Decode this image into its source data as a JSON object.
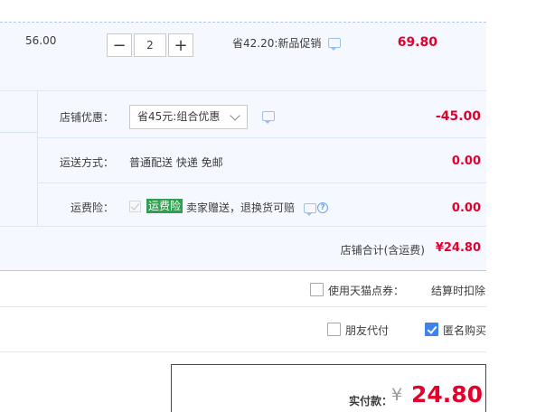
{
  "item": {
    "unit_price": "56.00",
    "minus_label": "−",
    "quantity": "2",
    "plus_label": "+",
    "promo_text": "省42.20:新品促销",
    "total": "69.80"
  },
  "shop": {
    "discount_label": "店铺优惠：",
    "discount_select": "省45元:组合优惠",
    "discount_value": "-45.00",
    "shipping_label": "运送方式：",
    "shipping_text": "普通配送 快递 免邮",
    "shipping_value": "0.00",
    "insurance_label": "运费险：",
    "insurance_tag": "运费险",
    "insurance_text": "卖家赠送，退换货可赔",
    "insurance_value": "0.00",
    "help_glyph": "?",
    "subtotal_label": "店铺合计(含运费)",
    "subtotal_value": "¥24.80"
  },
  "options": {
    "tmall_points_label": "使用天猫点券：",
    "tmall_points_note": "结算时扣除",
    "friend_pay_label": "朋友代付",
    "anonymous_label": "匿名购买"
  },
  "payment": {
    "label": "实付款：",
    "currency": "¥",
    "amount": "24.80"
  },
  "colors": {
    "accent_red": "#e4002b",
    "row_bg": "#f5f8ff",
    "checkbox_blue": "#3f83e8",
    "tag_green": "#2fa04f"
  }
}
